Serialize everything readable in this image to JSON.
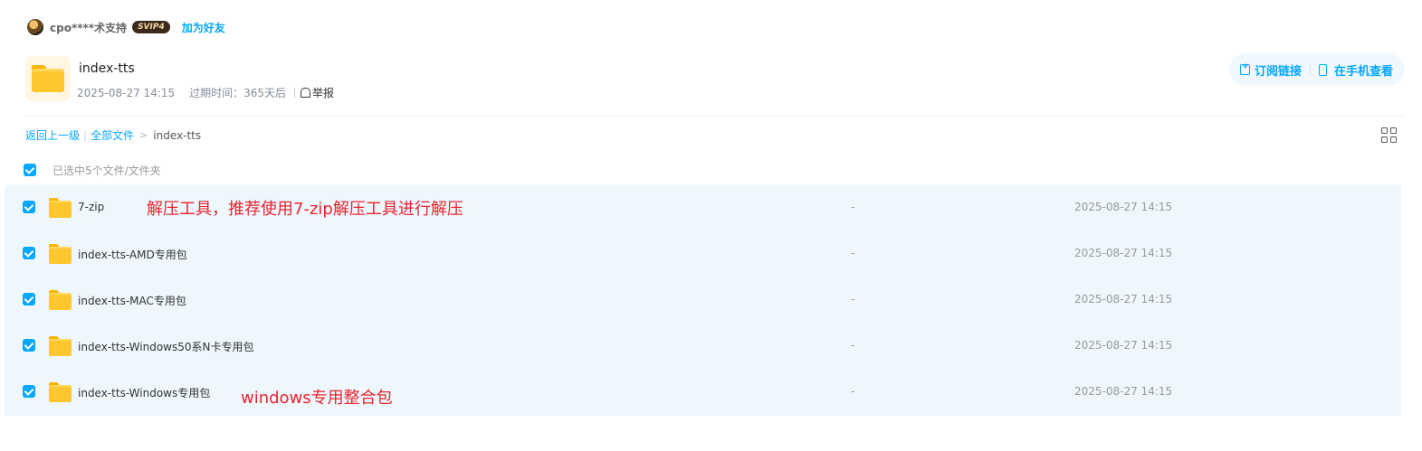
{
  "sharer": {
    "name": "cpo****术支持",
    "vip_badge": "SVIP4",
    "add_friend": "加为好友"
  },
  "share": {
    "title": "index-tts",
    "created": "2025-08-27 14:15",
    "expire": "过期时间：365天后",
    "report": "举报"
  },
  "actions": {
    "subscribe": "订阅链接",
    "view_on_phone": "在手机查看"
  },
  "breadcrumb": {
    "back": "返回上一级",
    "all_files": "全部文件",
    "separator": "|",
    "arrow": ">",
    "current": "index-tts"
  },
  "selection": {
    "count_text": "已选中5个文件/文件夹"
  },
  "files": [
    {
      "name": "7-zip",
      "size": "-",
      "time": "2025-08-27 14:15",
      "checked": true,
      "annotation": "解压工具，推荐使用7-zip解压工具进行解压"
    },
    {
      "name": "index-tts-AMD专用包",
      "size": "-",
      "time": "2025-08-27 14:15",
      "checked": true
    },
    {
      "name": "index-tts-MAC专用包",
      "size": "-",
      "time": "2025-08-27 14:15",
      "checked": true
    },
    {
      "name": "index-tts-Windows50系N卡专用包",
      "size": "-",
      "time": "2025-08-27 14:15",
      "checked": true
    },
    {
      "name": "index-tts-Windows专用包",
      "size": "-",
      "time": "2025-08-27 14:15",
      "checked": true,
      "annotation": "windows专用整合包"
    }
  ],
  "colors": {
    "accent": "#06a7ff",
    "row_selected_bg": "#eef7fe",
    "annotation": "#e8252d",
    "folder": "#ffc62d"
  }
}
